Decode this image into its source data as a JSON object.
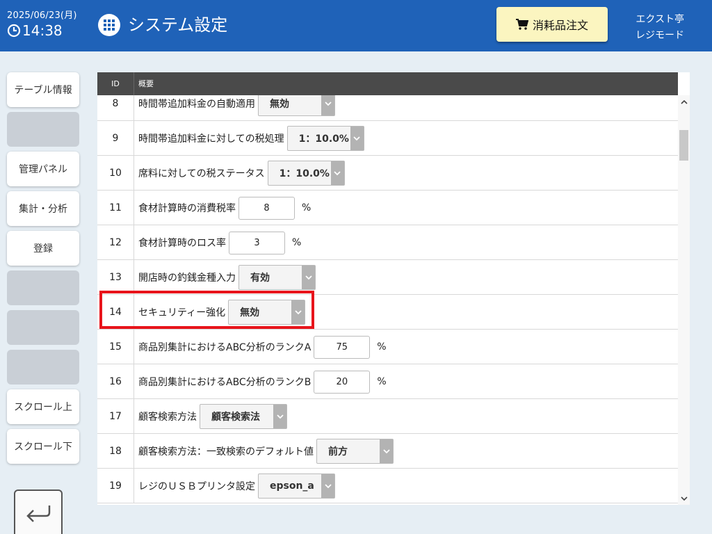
{
  "header": {
    "date": "2025/06/23(月)",
    "time": "14:38",
    "title": "システム設定",
    "order_button": "消耗品注文",
    "store_name": "エクスト亭",
    "mode": "レジモード",
    "icons": {
      "clock": "clock-icon",
      "menu": "grid-menu-icon",
      "cart": "cart-icon"
    }
  },
  "sidebar": {
    "buttons": [
      "テーブル情報",
      "",
      "管理パネル",
      "集計・分析",
      "登録",
      "",
      "",
      "",
      "スクロール上",
      "スクロール下"
    ],
    "back_icon": "return-arrow-icon"
  },
  "table": {
    "headers": {
      "id": "ID",
      "desc": "概要"
    },
    "rows": [
      {
        "id": "8",
        "label": "時間帯追加料金の自動適用",
        "control": "select",
        "value": "無効"
      },
      {
        "id": "9",
        "label": "時間帯追加料金に対しての税処理",
        "control": "select",
        "value": "1：10.0%"
      },
      {
        "id": "10",
        "label": "席料に対しての税ステータス",
        "control": "select",
        "value": "1：10.0%"
      },
      {
        "id": "11",
        "label": "食材計算時の消費税率",
        "control": "input",
        "value": "8",
        "unit": "%"
      },
      {
        "id": "12",
        "label": "食材計算時のロス率",
        "control": "input",
        "value": "3",
        "unit": "%"
      },
      {
        "id": "13",
        "label": "開店時の釣銭金種入力",
        "control": "select",
        "value": "有効"
      },
      {
        "id": "14",
        "label": "セキュリティー強化",
        "control": "select",
        "value": "無効"
      },
      {
        "id": "15",
        "label": "商品別集計におけるABC分析のランクA",
        "control": "input",
        "value": "75",
        "unit": "%"
      },
      {
        "id": "16",
        "label": "商品別集計におけるABC分析のランクB",
        "control": "input",
        "value": "20",
        "unit": "%"
      },
      {
        "id": "17",
        "label": "顧客検索方法",
        "control": "select",
        "value": "顧客検索法"
      },
      {
        "id": "18",
        "label": "顧客検索方法：一致検索のデフォルト値",
        "control": "select",
        "value": "前方"
      },
      {
        "id": "19",
        "label": "レジのＵＳＢプリンタ設定",
        "control": "select",
        "value": "epson_a"
      }
    ]
  },
  "colors": {
    "header_bg": "#1f62b8",
    "order_button_bg": "#fbf5c0",
    "highlight": "#e8141b",
    "table_header_bg": "#4a4a4a"
  }
}
